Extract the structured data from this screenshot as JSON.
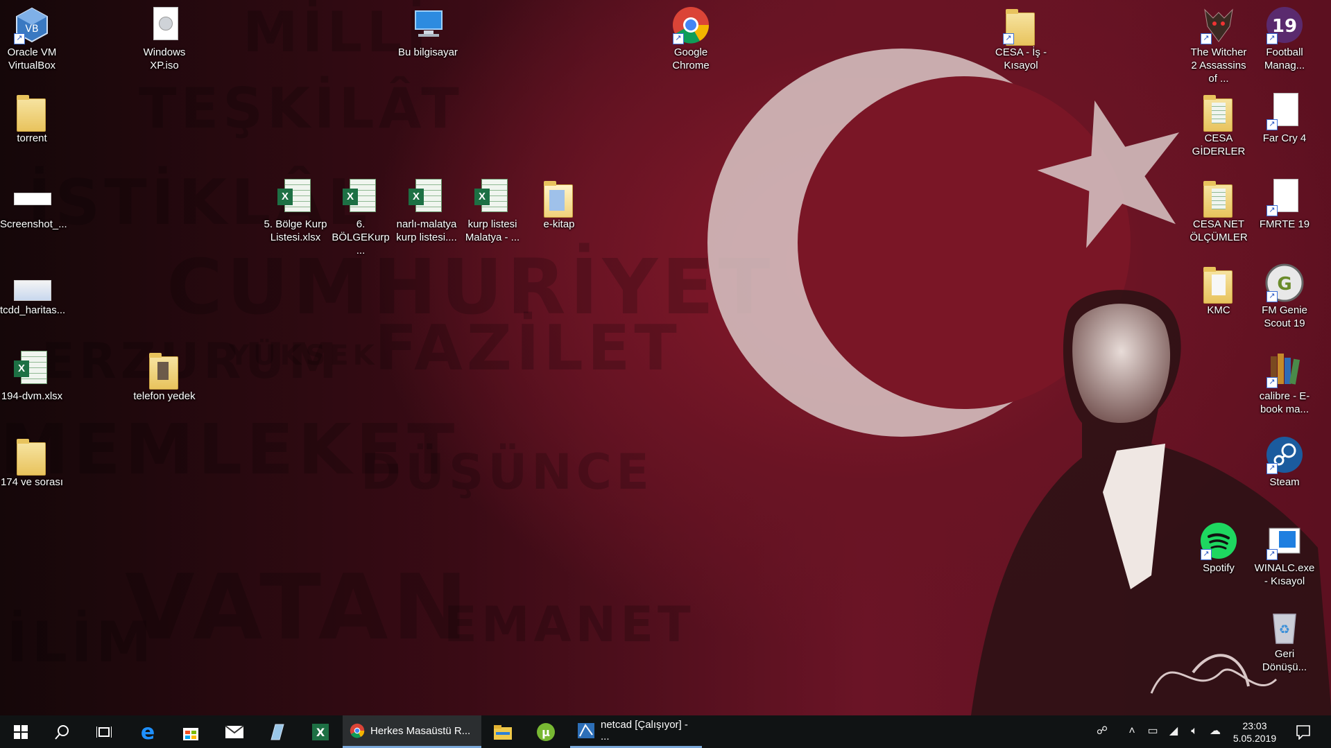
{
  "desktop": {
    "icons": [
      {
        "label": "Oracle VM VirtualBox",
        "icon": "virtualbox-icon"
      },
      {
        "label": "torrent",
        "icon": "folder-icon"
      },
      {
        "label": "Screenshot_...",
        "icon": "image-file-icon"
      },
      {
        "label": "tcdd_haritas...",
        "icon": "image-file-icon"
      },
      {
        "label": "194-dvm.xlsx",
        "icon": "excel-file-icon"
      },
      {
        "label": "174 ve sorası",
        "icon": "folder-icon"
      },
      {
        "label": "Windows XP.iso",
        "icon": "disc-image-icon"
      },
      {
        "label": "telefon yedek",
        "icon": "folder-icon"
      },
      {
        "label": "5. Bölge Kurp Listesi.xlsx",
        "icon": "excel-file-icon"
      },
      {
        "label": "6. BÖLGEKurp ...",
        "icon": "excel-file-icon"
      },
      {
        "label": "narlı-malatya kurp listesi....",
        "icon": "excel-file-icon"
      },
      {
        "label": "kurp listesi Malatya - ...",
        "icon": "excel-file-icon"
      },
      {
        "label": "e-kitap",
        "icon": "folder-icon"
      },
      {
        "label": "Bu bilgisayar",
        "icon": "computer-icon"
      },
      {
        "label": "Google Chrome",
        "icon": "chrome-icon"
      },
      {
        "label": "CESA - İş - Kısayol",
        "icon": "folder-shortcut-icon"
      },
      {
        "label": "The Witcher 2 Assassins of ...",
        "icon": "witcher-icon"
      },
      {
        "label": "Football Manag...",
        "icon": "football-manager-icon"
      },
      {
        "label": "CESA GİDERLER",
        "icon": "folder-icon"
      },
      {
        "label": "Far Cry 4",
        "icon": "file-shortcut-icon"
      },
      {
        "label": "CESA NET ÖLÇÜMLER",
        "icon": "folder-icon"
      },
      {
        "label": "FMRTE 19",
        "icon": "file-shortcut-icon"
      },
      {
        "label": "KMC",
        "icon": "folder-icon"
      },
      {
        "label": "FM Genie Scout 19",
        "icon": "fm-genie-icon"
      },
      {
        "label": "calibre - E-book ma...",
        "icon": "calibre-icon"
      },
      {
        "label": "Steam",
        "icon": "steam-icon"
      },
      {
        "label": "Spotify",
        "icon": "spotify-icon"
      },
      {
        "label": "WINALC.exe - Kısayol",
        "icon": "app-window-icon"
      },
      {
        "label": "Geri Dönüşü...",
        "icon": "recycle-bin-icon"
      }
    ]
  },
  "wallpaper": {
    "words": [
      "ERZURUM",
      "YÜKSEK",
      "FAZİLET",
      "MEMLEKET",
      "DÜŞÜNCE",
      "VATAN",
      "İLİM",
      "EMANET",
      "CUMHURİYET",
      "İSTİKLÂL",
      "TEŞKİLÂT",
      "MİLLİ"
    ]
  },
  "taskbar": {
    "apps": [
      {
        "label": "Herkes Masaüstü R...",
        "icon": "chrome-icon"
      },
      {
        "label": "netcad [Çalışıyor] - ...",
        "icon": "netcad-icon"
      }
    ],
    "clock_time": "23:03",
    "clock_date": "5.05.2019"
  },
  "colors": {
    "taskbar": "#101314",
    "flag_red": "#7a1626",
    "accent": "#7aa7d8",
    "excel": "#1d7044"
  }
}
